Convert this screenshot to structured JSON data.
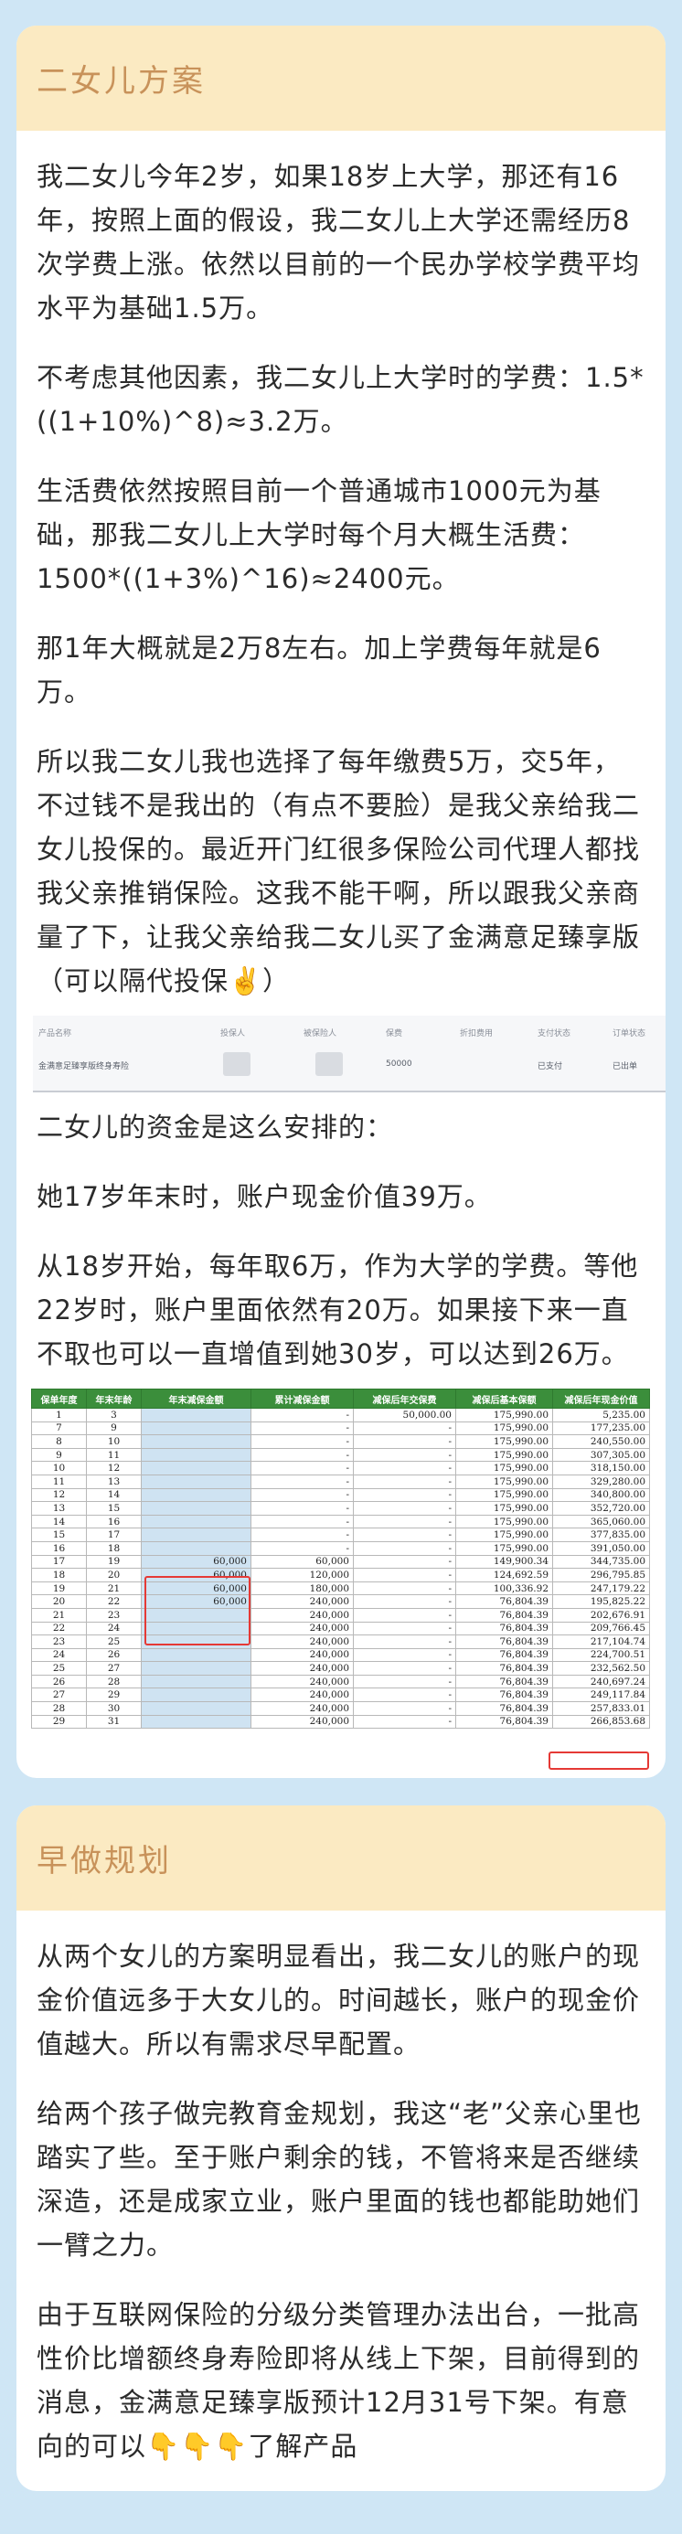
{
  "card1": {
    "title": "二女儿方案",
    "paragraphs": [
      "我二女儿今年2岁，如果18岁上大学，那还有16年，按照上面的假设，我二女儿上大学还需经历8次学费上涨。依然以目前的一个民办学校学费平均水平为基础1.5万。",
      "不考虑其他因素，我二女儿上大学时的学费：1.5*((1+10%)^8)≈3.2万。",
      "生活费依然按照目前一个普通城市1000元为基础，那我二女儿上大学时每个月大概生活费：1500*((1+3%)^16)≈2400元。",
      "那1年大概就是2万8左右。加上学费每年就是6万。",
      "所以我二女儿我也选择了每年缴费5万，交5年，不过钱不是我出的（有点不要脸）是我父亲给我二女儿投保的。最近开门红很多保险公司代理人都找我父亲推销保险。这我不能干啊，所以跟我父亲商量了下，让我父亲给我二女儿买了金满意足臻享版（可以隔代投保✌️）"
    ],
    "policy_table": {
      "headers": [
        "产品名称",
        "投保人",
        "被保险人",
        "保费",
        "折扣费用",
        "支付状态",
        "订单状态"
      ],
      "row": [
        "金满意足臻享版终身寿险",
        "",
        "",
        "50000",
        "",
        "已支付",
        "已出单"
      ]
    },
    "paragraphs2": [
      "二女儿的资金是这么安排的：",
      "她17岁年末时，账户现金价值39万。",
      "从18岁开始，每年取6万，作为大学的学费。等他22岁时，账户里面依然有20万。如果接下来一直不取也可以一直增值到她30岁，可以达到26万。"
    ],
    "value_table": {
      "headers": [
        "保单年度",
        "年末年龄",
        "年末减保金额",
        "累计减保金额",
        "减保后年交保费",
        "减保后基本保额",
        "减保后年现金价值"
      ],
      "rows": [
        [
          "1",
          "3",
          "",
          "-",
          "50,000.00",
          "175,990.00",
          "5,235.00"
        ],
        [
          "7",
          "9",
          "",
          "-",
          "-",
          "175,990.00",
          "177,235.00"
        ],
        [
          "8",
          "10",
          "",
          "-",
          "-",
          "175,990.00",
          "240,550.00"
        ],
        [
          "9",
          "11",
          "",
          "-",
          "-",
          "175,990.00",
          "307,305.00"
        ],
        [
          "10",
          "12",
          "",
          "-",
          "-",
          "175,990.00",
          "318,150.00"
        ],
        [
          "11",
          "13",
          "",
          "-",
          "-",
          "175,990.00",
          "329,280.00"
        ],
        [
          "12",
          "14",
          "",
          "-",
          "-",
          "175,990.00",
          "340,800.00"
        ],
        [
          "13",
          "15",
          "",
          "-",
          "-",
          "175,990.00",
          "352,720.00"
        ],
        [
          "14",
          "16",
          "",
          "-",
          "-",
          "175,990.00",
          "365,060.00"
        ],
        [
          "15",
          "17",
          "",
          "-",
          "-",
          "175,990.00",
          "377,835.00"
        ],
        [
          "16",
          "18",
          "",
          "-",
          "-",
          "175,990.00",
          "391,050.00"
        ],
        [
          "17",
          "19",
          "60,000",
          "60,000",
          "-",
          "149,900.34",
          "344,735.00"
        ],
        [
          "18",
          "20",
          "60,000",
          "120,000",
          "-",
          "124,692.59",
          "296,795.85"
        ],
        [
          "19",
          "21",
          "60,000",
          "180,000",
          "-",
          "100,336.92",
          "247,179.22"
        ],
        [
          "20",
          "22",
          "60,000",
          "240,000",
          "-",
          "76,804.39",
          "195,825.22"
        ],
        [
          "21",
          "23",
          "",
          "240,000",
          "-",
          "76,804.39",
          "202,676.91"
        ],
        [
          "22",
          "24",
          "",
          "240,000",
          "-",
          "76,804.39",
          "209,766.45"
        ],
        [
          "23",
          "25",
          "",
          "240,000",
          "-",
          "76,804.39",
          "217,104.74"
        ],
        [
          "24",
          "26",
          "",
          "240,000",
          "-",
          "76,804.39",
          "224,700.51"
        ],
        [
          "25",
          "27",
          "",
          "240,000",
          "-",
          "76,804.39",
          "232,562.50"
        ],
        [
          "26",
          "28",
          "",
          "240,000",
          "-",
          "76,804.39",
          "240,697.24"
        ],
        [
          "27",
          "29",
          "",
          "240,000",
          "-",
          "76,804.39",
          "249,117.84"
        ],
        [
          "28",
          "30",
          "",
          "240,000",
          "-",
          "76,804.39",
          "257,833.01"
        ],
        [
          "29",
          "31",
          "",
          "240,000",
          "-",
          "76,804.39",
          "266,853.68"
        ]
      ]
    }
  },
  "card2": {
    "title": "早做规划",
    "paragraphs": [
      "从两个女儿的方案明显看出，我二女儿的账户的现金价值远多于大女儿的。时间越长，账户的现金价值越大。所以有需求尽早配置。",
      "给两个孩子做完教育金规划，我这“老”父亲心里也踏实了些。至于账户剩余的钱，不管将来是否继续深造，还是成家立业，账户里面的钱也都能助她们一臂之力。",
      "由于互联网保险的分级分类管理办法出台，一批高性价比增额终身寿险即将从线上下架，目前得到的消息，金满意足臻享版预计12月31号下架。有意向的可以👇👇👇了解产品"
    ]
  },
  "colors": {
    "page_bg": "#cfe6f5",
    "header_bg": "#fbeac2",
    "title_color": "#c8925a",
    "table_header": "#3b8e3b",
    "table_blue": "#cfe3f2",
    "highlight": "#e53935"
  }
}
